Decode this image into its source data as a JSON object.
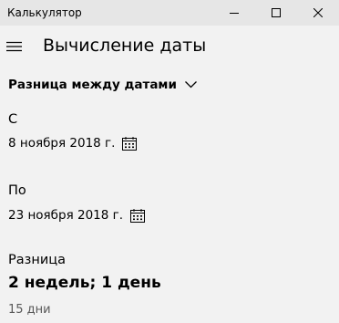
{
  "window": {
    "title": "Калькулятор",
    "controls": [
      "minimize",
      "maximize",
      "close"
    ]
  },
  "header": {
    "menu_icon": "hamburger-menu-icon",
    "title": "Вычисление даты"
  },
  "mode": {
    "selected": "Разница между датами",
    "icon": "chevron-down-icon"
  },
  "from": {
    "label": "С",
    "date": "8 ноября 2018 г.",
    "icon": "calendar-icon"
  },
  "to": {
    "label": "По",
    "date": "23 ноября 2018 г.",
    "icon": "calendar-icon"
  },
  "result": {
    "label": "Разница",
    "value": "2 недель; 1 день",
    "days": "15 дни"
  },
  "colors": {
    "background": "#f2f2f2",
    "titlebar": "#e6e6e6",
    "secondary_text": "#595959"
  }
}
